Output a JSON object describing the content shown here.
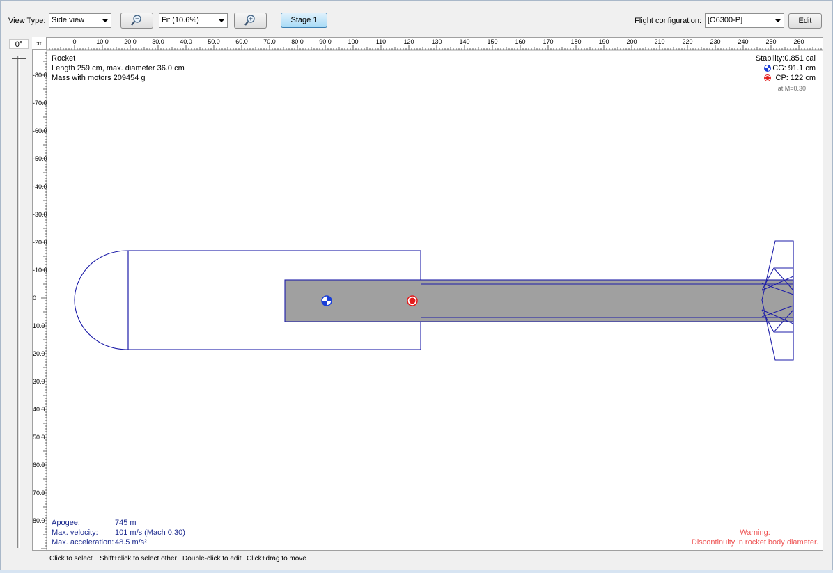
{
  "toolbar": {
    "view_type_label": "View Type:",
    "view_type_value": "Side view",
    "zoom_value": "Fit (10.6%)",
    "stage_label": "Stage 1",
    "flight_config_label": "Flight configuration:",
    "flight_config_value": "[O6300-P]",
    "edit_label": "Edit"
  },
  "rotation": {
    "angle": "0°"
  },
  "ruler": {
    "unit": "cm",
    "top_labels": [
      "0",
      "10.0",
      "20.0",
      "30.0",
      "40.0",
      "50.0",
      "60.0",
      "70.0",
      "80.0",
      "90.0",
      "100",
      "110",
      "120",
      "130",
      "140",
      "150",
      "160",
      "170",
      "180",
      "190",
      "200",
      "210",
      "220",
      "230",
      "240",
      "250",
      "260"
    ],
    "side_labels": [
      "-80.0",
      "-70.0",
      "-60.0",
      "-50.0",
      "-40.0",
      "-30.0",
      "-20.0",
      "-10.0",
      "0",
      "10.0",
      "20.0",
      "30.0",
      "40.0",
      "50.0",
      "60.0",
      "70.0",
      "80.0"
    ]
  },
  "rocket_info": {
    "name": "Rocket",
    "length_line": "Length 259 cm, max. diameter 36.0 cm",
    "mass_line": "Mass with motors 209454 g"
  },
  "stability": {
    "stability_line": "Stability:0.851 cal",
    "cg_line": "CG: 91.1 cm",
    "cp_line": "CP:  122 cm",
    "mach_line": "at M=0.30",
    "cg_color": "#1a3fd8",
    "cp_color": "#e31c1c"
  },
  "flight": {
    "apogee_label": "Apogee:",
    "apogee_value": "745 m",
    "velocity_label": "Max. velocity:",
    "velocity_value": "101 m/s  (Mach 0.30)",
    "accel_label": "Max. acceleration:",
    "accel_value": "48.5 m/s²"
  },
  "warning": {
    "title": "Warning:",
    "message": "Discontinuity in rocket body diameter."
  },
  "status_bar": {
    "hint1": "Click to select",
    "hint2": "Shift+click to select other",
    "hint3": "Double-click to edit",
    "hint4": "Click+drag to move"
  },
  "colors": {
    "outline": "#1c1ca8",
    "motor_fill": "#a0a0a0"
  }
}
